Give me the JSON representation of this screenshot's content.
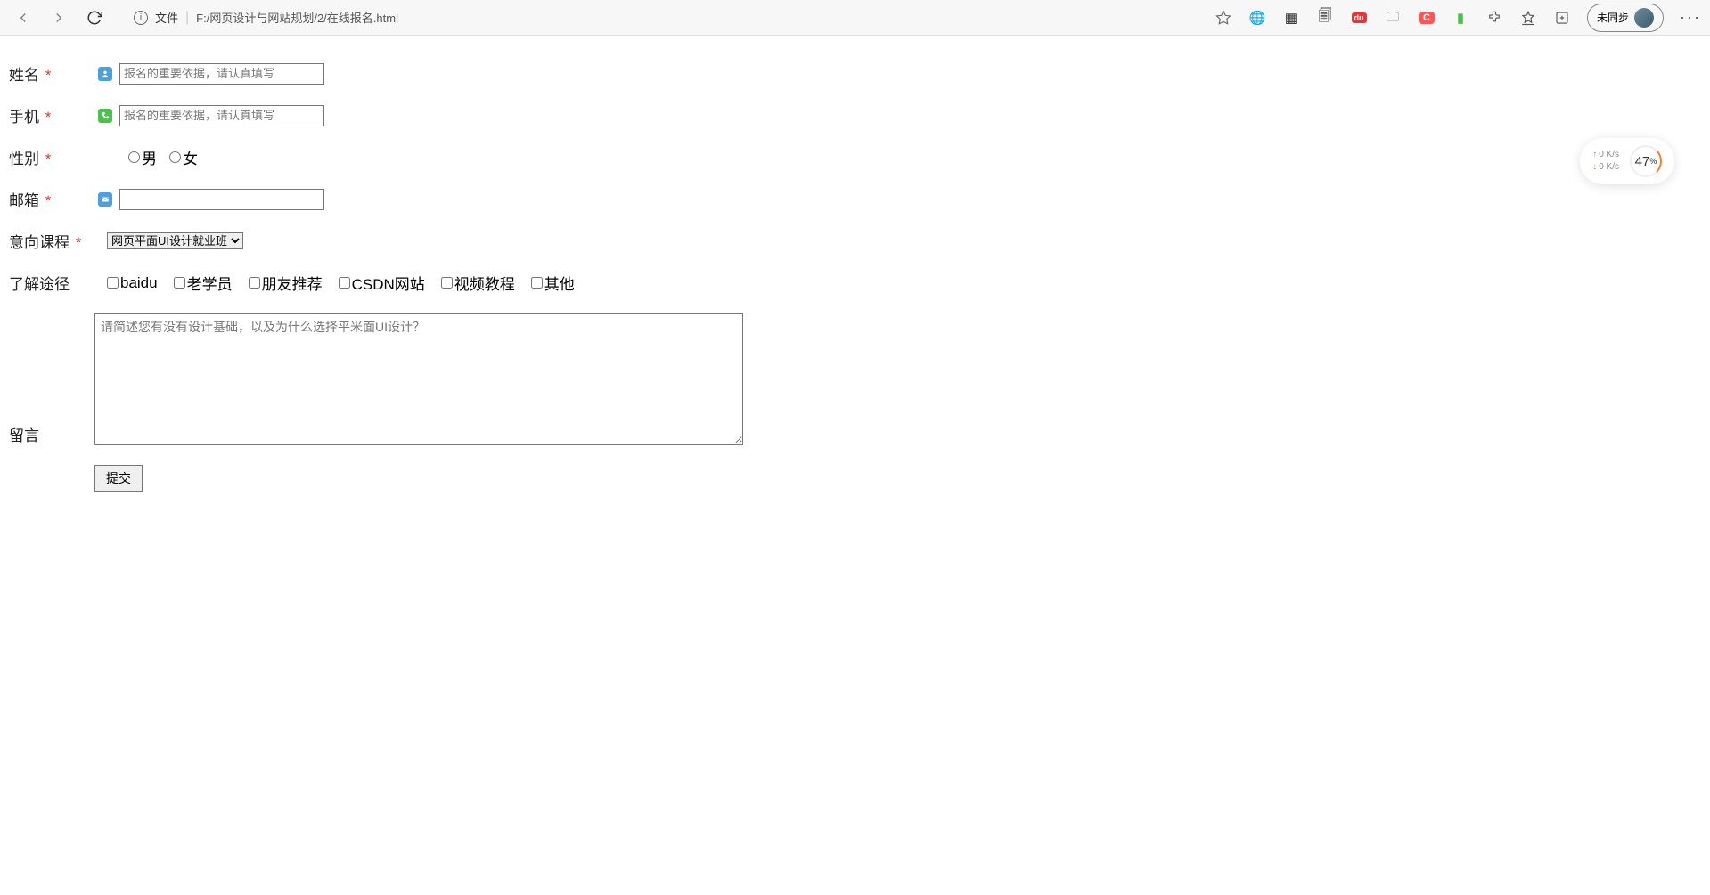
{
  "chrome": {
    "addr_label": "文件",
    "addr_url": "F:/网页设计与网站规划/2/在线报名.html",
    "sync_label": "未同步"
  },
  "form": {
    "name": {
      "label": "姓名",
      "placeholder": "报名的重要依据，请认真填写"
    },
    "phone": {
      "label": "手机",
      "placeholder": "报名的重要依据，请认真填写"
    },
    "gender": {
      "label": "性别",
      "opt_male": "男",
      "opt_female": "女"
    },
    "email": {
      "label": "邮箱"
    },
    "course": {
      "label": "意向课程",
      "selected": "网页平面UI设计就业班"
    },
    "source": {
      "label": "了解途径",
      "opts": [
        "baidu",
        "老学员",
        "朋友推荐",
        "CSDN网站",
        "视频教程",
        "其他"
      ]
    },
    "message": {
      "label": "留言",
      "placeholder": "请简述您有没有设计基础，以及为什么选择平米面UI设计？"
    },
    "submit": "提交"
  },
  "net": {
    "up": "0  K/s",
    "down": "0  K/s",
    "pct": "47",
    "pct_unit": "%"
  }
}
